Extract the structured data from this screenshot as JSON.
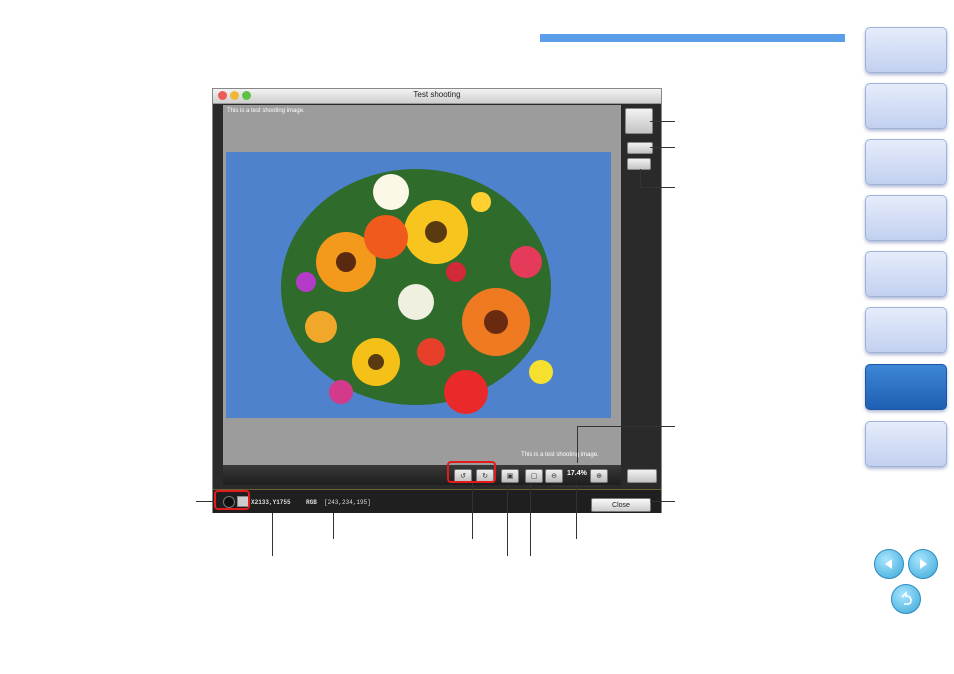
{
  "window": {
    "title": "Test shooting",
    "canvas_note_top": "This is a test shooting image.",
    "canvas_note_bottom": "This is a test shooting image.",
    "zoom": "17.4%",
    "coords": "X2133,Y1755",
    "rgb_label": "RGB",
    "rgb_value": "[243,234,195]",
    "close_label": "Close"
  },
  "colors": {
    "accent_bar": "#5a9de8",
    "nav_tab": "#c2d0f0",
    "nav_tab_active": "#1f5fb3",
    "highlight": "#e21b1b",
    "photo_bg": "#4d7fc8"
  },
  "nav": {
    "tabs": [
      "tab-1",
      "tab-2",
      "tab-3",
      "tab-4",
      "tab-5",
      "tab-6",
      "tab-7",
      "tab-8"
    ],
    "active_index": 6,
    "icons": [
      "prev-page-icon",
      "next-page-icon",
      "return-icon"
    ]
  }
}
